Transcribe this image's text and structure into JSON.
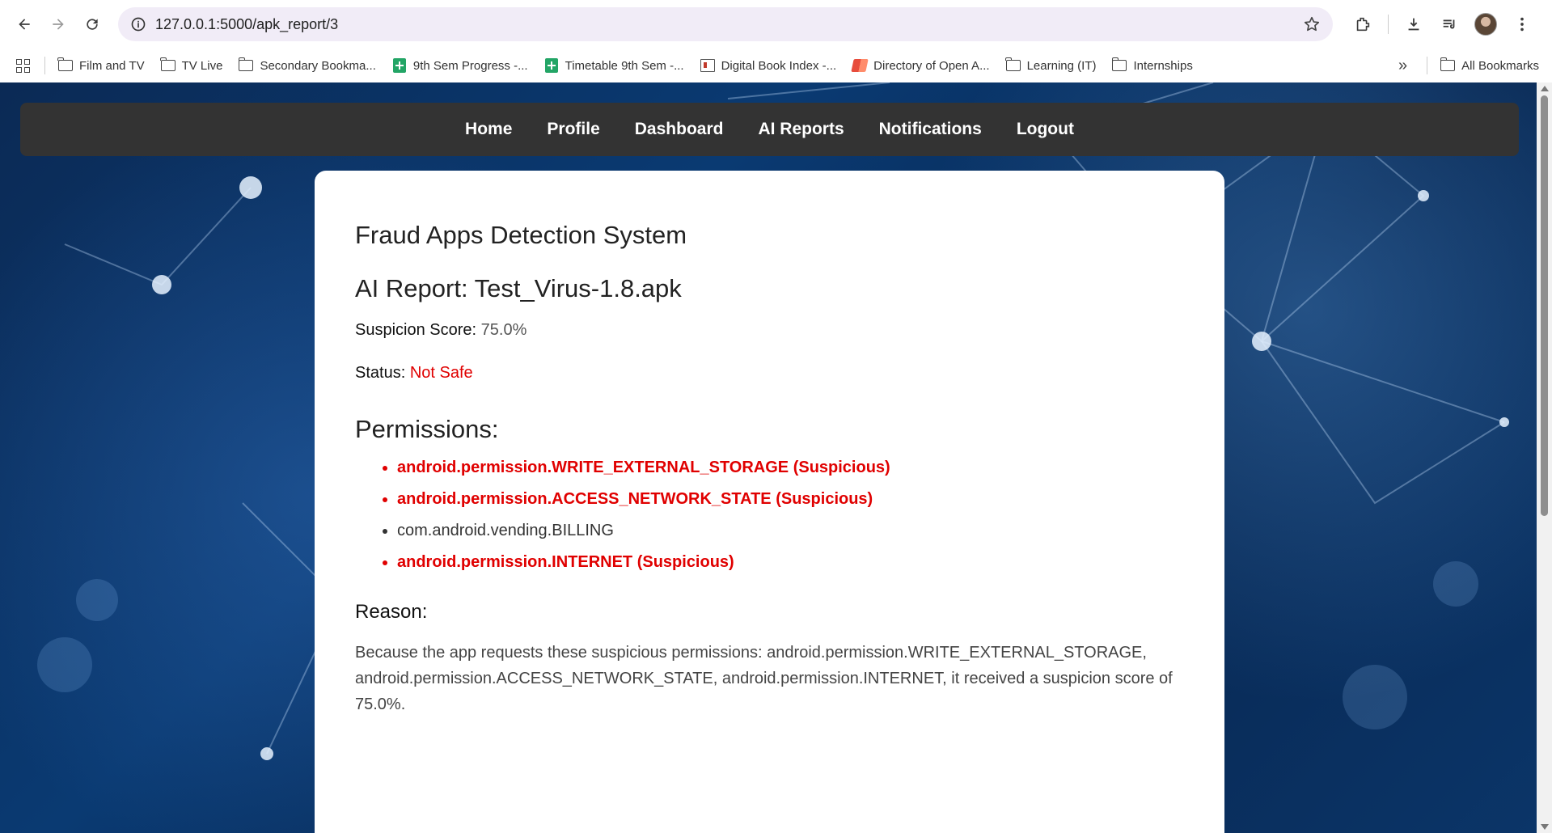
{
  "browser": {
    "url": "127.0.0.1:5000/apk_report/3",
    "bookmarks": [
      {
        "label": "Film and TV",
        "icon": "folder-icon"
      },
      {
        "label": "TV Live",
        "icon": "folder-icon"
      },
      {
        "label": "Secondary Bookma...",
        "icon": "folder-icon"
      },
      {
        "label": "9th Sem Progress -...",
        "icon": "sheets-icon"
      },
      {
        "label": "Timetable 9th Sem -...",
        "icon": "sheets-icon"
      },
      {
        "label": "Digital Book Index -...",
        "icon": "book-icon"
      },
      {
        "label": "Directory of Open A...",
        "icon": "red-book-icon"
      },
      {
        "label": "Learning (IT)",
        "icon": "folder-icon"
      },
      {
        "label": "Internships",
        "icon": "folder-icon"
      }
    ],
    "all_bookmarks": "All Bookmarks"
  },
  "nav": {
    "items": [
      "Home",
      "Profile",
      "Dashboard",
      "AI Reports",
      "Notifications",
      "Logout"
    ]
  },
  "report": {
    "system_title": "Fraud Apps Detection System",
    "title": "AI Report: Test_Virus-1.8.apk",
    "score_label": "Suspicion Score:",
    "score_value": "75.0%",
    "status_label": "Status:",
    "status_value": "Not Safe",
    "permissions_heading": "Permissions:",
    "permissions": [
      {
        "text": "android.permission.WRITE_EXTERNAL_STORAGE (Suspicious)",
        "suspicious": true
      },
      {
        "text": "android.permission.ACCESS_NETWORK_STATE (Suspicious)",
        "suspicious": true
      },
      {
        "text": "com.android.vending.BILLING",
        "suspicious": false
      },
      {
        "text": "android.permission.INTERNET (Suspicious)",
        "suspicious": true
      }
    ],
    "reason_heading": "Reason:",
    "reason_text": "Because the app requests these suspicious permissions: android.permission.WRITE_EXTERNAL_STORAGE, android.permission.ACCESS_NETWORK_STATE, android.permission.INTERNET, it received a suspicion score of 75.0%."
  },
  "colors": {
    "danger": "#e00000",
    "navbar_bg": "#333333"
  }
}
